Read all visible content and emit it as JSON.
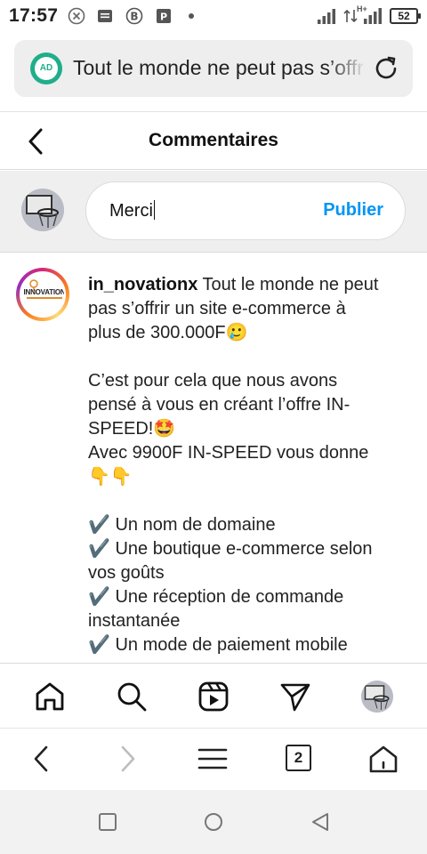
{
  "status_bar": {
    "time": "17:57",
    "battery": "52",
    "network": "H+"
  },
  "browser": {
    "site_badge": "AD",
    "url_text": "Tout le monde ne peut pas s’offrir un site e-commerce",
    "tab_count": "2"
  },
  "header": {
    "title": "Commentaires"
  },
  "composer": {
    "input_value": "Merci",
    "publish_label": "Publier"
  },
  "post": {
    "logo_text": "INNOVATION",
    "username": "in_novationx",
    "lines": [
      " Tout le monde ne peut",
      "pas s’offrir un site e-commerce à",
      "plus de 300.000F🥲",
      "",
      "C’est pour cela que nous avons",
      "pensé à vous en créant l’offre IN-",
      "SPEED!🤩",
      "Avec 9900F IN-SPEED vous donne",
      "👇👇",
      "",
      "✔️ Un nom de domaine",
      "✔️ Une boutique e-commerce selon",
      "vos goûts",
      "✔️ Une réception de commande",
      "instantanée",
      "✔️ Un mode de paiement mobile"
    ]
  },
  "app_nav": {
    "items": [
      "home-icon",
      "search-icon",
      "reels-icon",
      "direct-messages-icon",
      "profile-avatar"
    ]
  },
  "browser_toolbar": {
    "items": [
      "back-icon",
      "forward-icon",
      "menu-icon",
      "tabs-icon",
      "home-icon"
    ]
  },
  "colors": {
    "accent": "#0095f6",
    "badge": "#1fae8b",
    "composer_bg": "#efefef"
  }
}
